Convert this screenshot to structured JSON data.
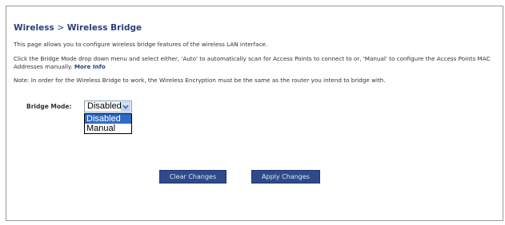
{
  "page": {
    "section": "Wireless",
    "separator": ">",
    "subsection": "Wireless Bridge",
    "intro": "This page allows you to configure wireless bridge features of the wireless LAN interface.",
    "instructions": "Click the Bridge Mode drop down menu and select either, 'Auto' to automatically scan for Access Points to connect to or, 'Manual' to configure the Access Points MAC Addresses manually.",
    "more_info": "More Info",
    "note": "Note: In order for the Wireless Bridge to work, the Wireless Encryption must be the same as the router you intend to bridge with."
  },
  "bridge_mode": {
    "label": "Bridge Mode:",
    "selected": "Disabled",
    "options": [
      "Disabled",
      "Manual"
    ]
  },
  "buttons": {
    "clear": "Clear Changes",
    "apply": "Apply Changes"
  },
  "colors": {
    "title": "#2b3f7a",
    "button_bg": "#2e4a8a",
    "dropdown_highlight": "#316ac5"
  },
  "icons": {
    "select_arrow": "chevron-down-icon"
  }
}
